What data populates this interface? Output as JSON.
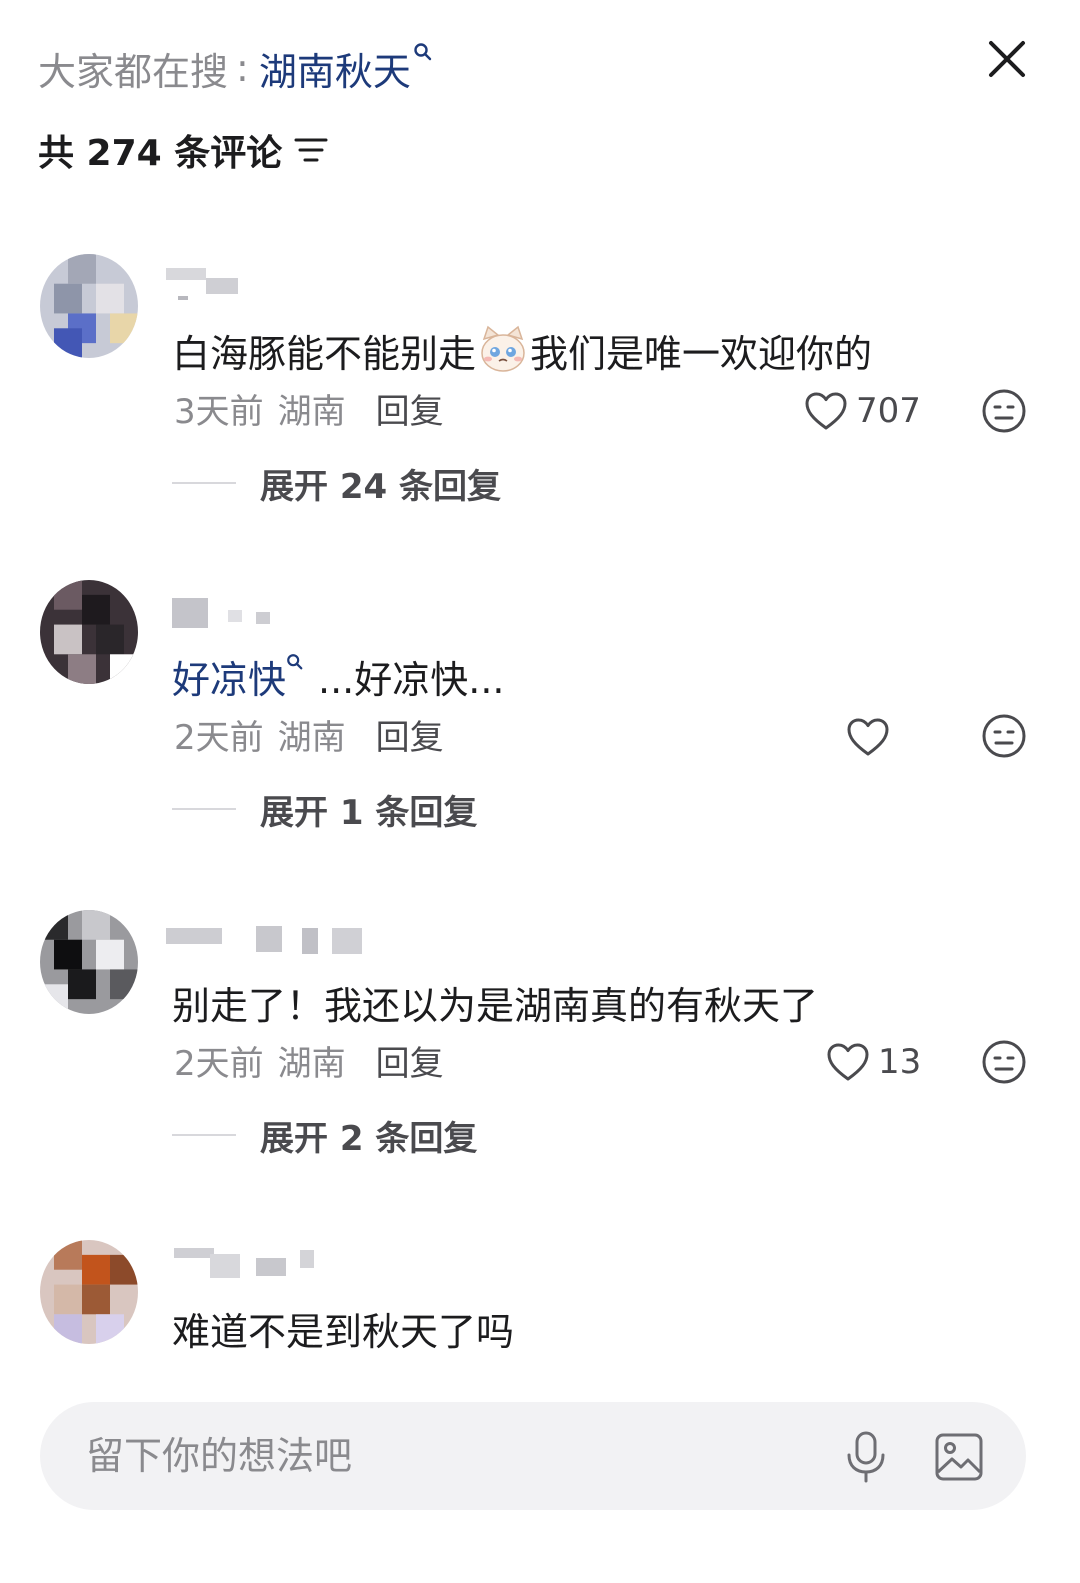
{
  "header": {
    "search_prefix": "大家都在搜",
    "search_colon": ":",
    "search_term": "湖南秋天",
    "comment_count_label": "共 274 条评论"
  },
  "comments": [
    {
      "text": "白海豚能不能别走",
      "text_after_emoji": "我们是唯一欢迎你的",
      "emoji": "crying-cat-emoji",
      "time": "3天前",
      "location": "湖南",
      "reply_label": "回复",
      "like_count": "707",
      "expand_label": "展开 24 条回复"
    },
    {
      "topic": "好凉快",
      "text": "...好凉快...",
      "time": "2天前",
      "location": "湖南",
      "reply_label": "回复",
      "like_count": "",
      "expand_label": "展开 1 条回复"
    },
    {
      "text": "别走了！我还以为是湖南真的有秋天了",
      "time": "2天前",
      "location": "湖南",
      "reply_label": "回复",
      "like_count": "13",
      "expand_label": "展开 2 条回复"
    },
    {
      "text": "难道不是到秋天了吗"
    }
  ],
  "input": {
    "placeholder": "留下你的想法吧"
  },
  "icons": {
    "close": "close-icon",
    "sort": "sort-icon",
    "like": "heart-outline-icon",
    "react": "emoji-face-icon",
    "mic": "microphone-icon",
    "image": "image-icon",
    "search_mark": "search-icon"
  },
  "colors": {
    "link": "#1d3a7a",
    "muted": "#8a8a8e",
    "input_bg": "#f2f2f4"
  }
}
